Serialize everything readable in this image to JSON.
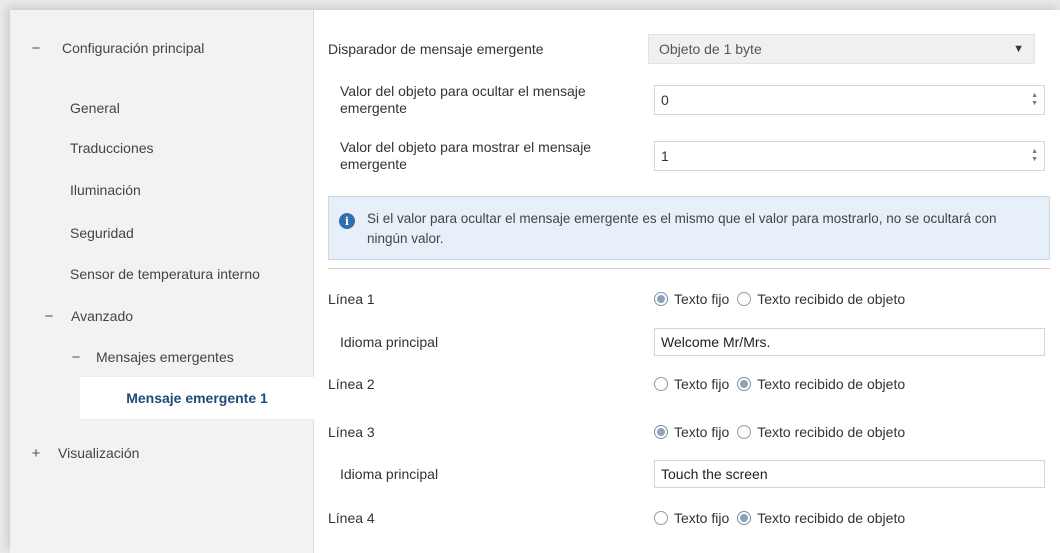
{
  "sidebar": {
    "main_config": {
      "toggle": "−",
      "label": "Configuración principal"
    },
    "items": [
      {
        "label": "General"
      },
      {
        "label": "Traducciones"
      },
      {
        "label": "Iluminación"
      },
      {
        "label": "Seguridad"
      },
      {
        "label": "Sensor de temperatura interno"
      }
    ],
    "advanced": {
      "toggle": "−",
      "label": "Avanzado"
    },
    "popup_messages": {
      "toggle": "−",
      "label": "Mensajes emergentes"
    },
    "selected_item": {
      "label": "Mensaje emergente 1"
    },
    "display": {
      "toggle": "+",
      "label": "Visualización"
    }
  },
  "main": {
    "trigger": {
      "label": "Disparador de mensaje emergente",
      "value": "Objeto de 1 byte"
    },
    "hide_value": {
      "label": "Valor del objeto para ocultar el mensaje emergente",
      "value": "0"
    },
    "show_value": {
      "label": "Valor del objeto para mostrar el mensaje emergente",
      "value": "1"
    },
    "info": {
      "text": "Si el valor para ocultar el mensaje emergente es el mismo que el valor para mostrarlo, no se ocultará con ningún valor."
    },
    "option_fixed": "Texto fijo",
    "option_object": "Texto recibido de objeto",
    "language_label": "Idioma principal",
    "lines": [
      {
        "label": "Línea 1",
        "selected": "fixed",
        "text": "Welcome Mr/Mrs."
      },
      {
        "label": "Línea 2",
        "selected": "object"
      },
      {
        "label": "Línea 3",
        "selected": "fixed",
        "text": "Touch the screen"
      },
      {
        "label": "Línea 4",
        "selected": "object"
      }
    ]
  },
  "colors": {
    "accent": "#1e4b7a",
    "info_bg": "#e7f0f9",
    "info_icon": "#2f6fae"
  }
}
